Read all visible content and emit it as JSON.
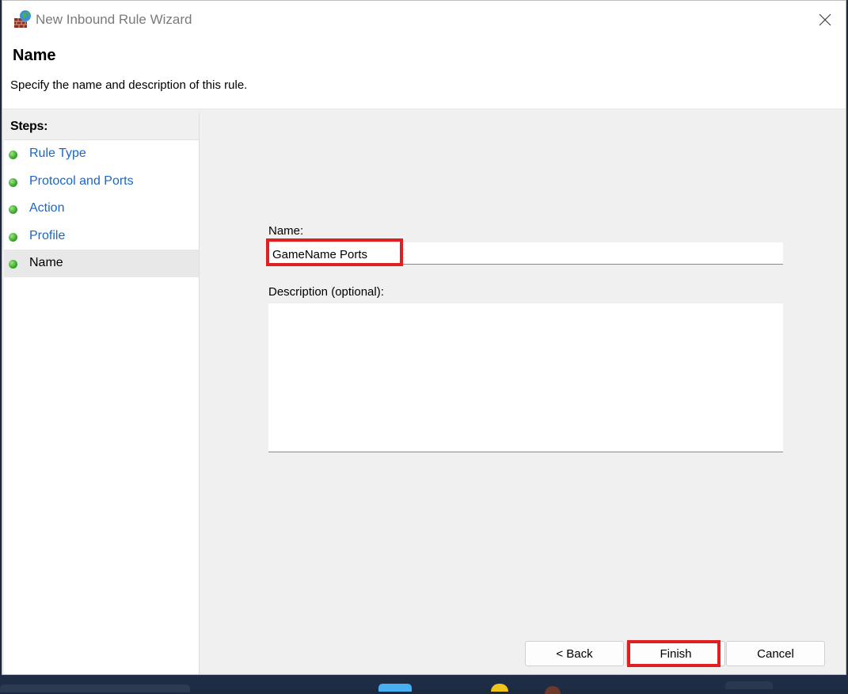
{
  "window": {
    "title": "New Inbound Rule Wizard",
    "icon": "firewall-globe-icon"
  },
  "header": {
    "title": "Name",
    "subtitle": "Specify the name and description of this rule."
  },
  "steps": {
    "heading": "Steps:",
    "items": [
      {
        "label": "Rule Type",
        "active": false
      },
      {
        "label": "Protocol and Ports",
        "active": false
      },
      {
        "label": "Action",
        "active": false
      },
      {
        "label": "Profile",
        "active": false
      },
      {
        "label": "Name",
        "active": true
      }
    ]
  },
  "form": {
    "name_label": "Name:",
    "name_value": "GameName Ports",
    "description_label": "Description (optional):",
    "description_value": ""
  },
  "buttons": {
    "back": "< Back",
    "finish": "Finish",
    "cancel": "Cancel"
  },
  "colors": {
    "link": "#1a66c8",
    "highlight": "#e02020",
    "step_dot": "#3fae2a"
  }
}
